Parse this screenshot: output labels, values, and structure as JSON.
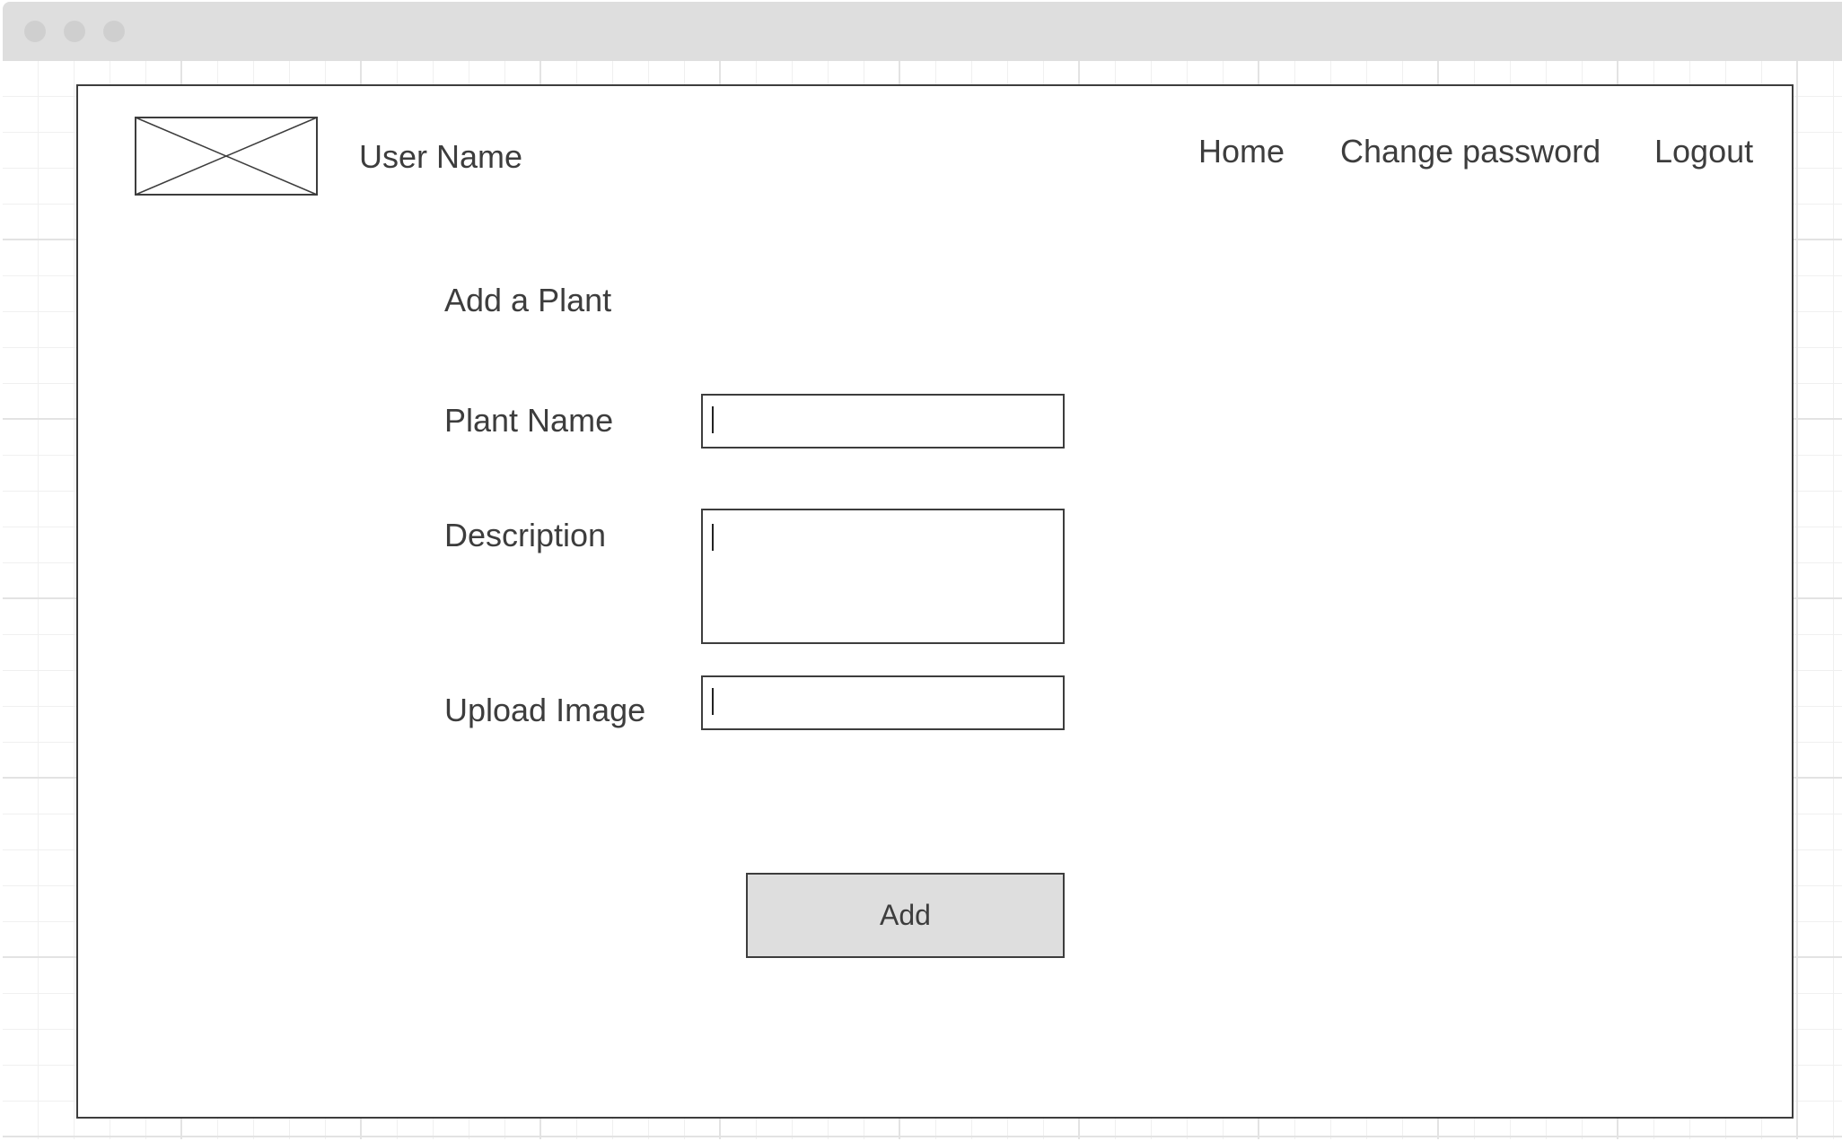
{
  "window": {
    "controls": [
      "close-button",
      "minimize-button",
      "zoom-button"
    ]
  },
  "header": {
    "logo_icon": "image-placeholder-icon",
    "user_name": "User Name",
    "nav": {
      "home": "Home",
      "change_password": "Change password",
      "logout": "Logout"
    }
  },
  "form": {
    "title": "Add a Plant",
    "fields": {
      "plant_name": {
        "label": "Plant Name",
        "value": ""
      },
      "description": {
        "label": "Description",
        "value": ""
      },
      "upload_image": {
        "label": "Upload Image",
        "value": ""
      }
    },
    "submit_label": "Add"
  },
  "colors": {
    "chrome": "#dedede",
    "stroke": "#3d3d3d",
    "text": "#3d3d3d",
    "button_fill": "#dedede",
    "grid": "#e3e3e3"
  }
}
